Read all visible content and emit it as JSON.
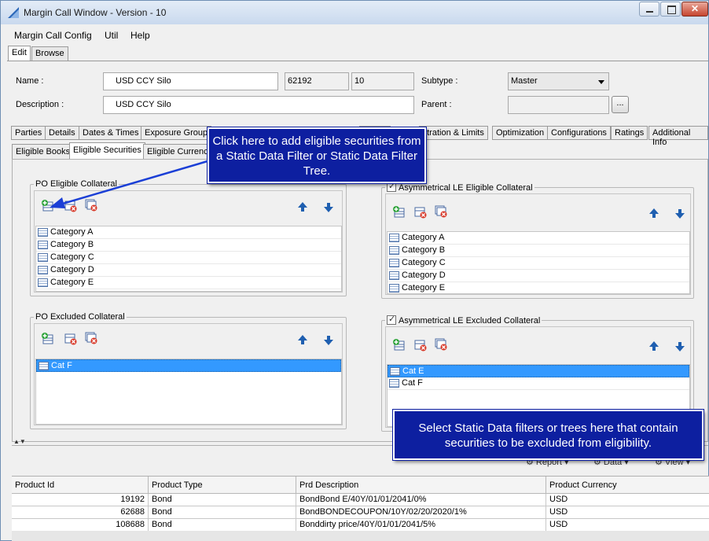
{
  "window": {
    "title": "Margin Call Window - Version - 10",
    "close_glyph": "✕"
  },
  "menu": [
    "Margin Call Config",
    "Util",
    "Help"
  ],
  "mode_tabs": [
    "Edit",
    "Browse"
  ],
  "header": {
    "name_label": "Name :",
    "name_value": "USD CCY Silo",
    "id_value": "62192",
    "version_value": "10",
    "subtype_label": "Subtype :",
    "subtype_value": "Master",
    "description_label": "Description :",
    "description_value": "USD CCY Silo",
    "parent_label": "Parent :",
    "parent_value": "",
    "parent_button": "..."
  },
  "main_tabs": [
    "Parties",
    "Details",
    "Dates & Times",
    "Exposure Group",
    "ntration & Limits",
    "Optimization",
    "Configurations",
    "Ratings",
    "Additional Info"
  ],
  "sub_tabs": [
    "Eligible Books",
    "Eligible Securities",
    "Eligible Currenci"
  ],
  "po_eligible": {
    "title": "PO Eligible Collateral",
    "items": [
      "Category A",
      "Category B",
      "Category C",
      "Category D",
      "Category E"
    ]
  },
  "po_excluded": {
    "title": "PO Excluded Collateral",
    "items": [
      "Cat F"
    ]
  },
  "le_eligible": {
    "title": "Asymmetrical LE Eligible Collateral",
    "checked": true,
    "items": [
      "Category A",
      "Category B",
      "Category C",
      "Category D",
      "Category E"
    ]
  },
  "le_excluded": {
    "title": "Asymmetrical LE Excluded Collateral",
    "checked": true,
    "items": [
      "Cat E",
      "Cat F"
    ]
  },
  "callouts": {
    "add_securities": "Click here to add eligible securities from a Static Data Filter or Static Data Filter Tree.",
    "exclude_info": "Select Static Data filters or trees here that contain securities to be excluded from eligibility."
  },
  "bottom_toolbar": {
    "report": "Report",
    "data": "Data",
    "view": "View"
  },
  "grid": {
    "columns": [
      "Product Id",
      "Product Type",
      "Prd Description",
      "Product Currency"
    ],
    "rows": [
      [
        "19192",
        "Bond",
        "BondBond E/40Y/01/01/2041/0%",
        "USD"
      ],
      [
        "62688",
        "Bond",
        "BondBONDECOUPON/10Y/02/20/2020/1%",
        "USD"
      ],
      [
        "108688",
        "Bond",
        "Bonddirty price/40Y/01/01/2041/5%",
        "USD"
      ]
    ]
  },
  "colors": {
    "callout_bg": "#0d1fa0",
    "selection": "#3399ff",
    "arrow": "#1b3fd6"
  }
}
